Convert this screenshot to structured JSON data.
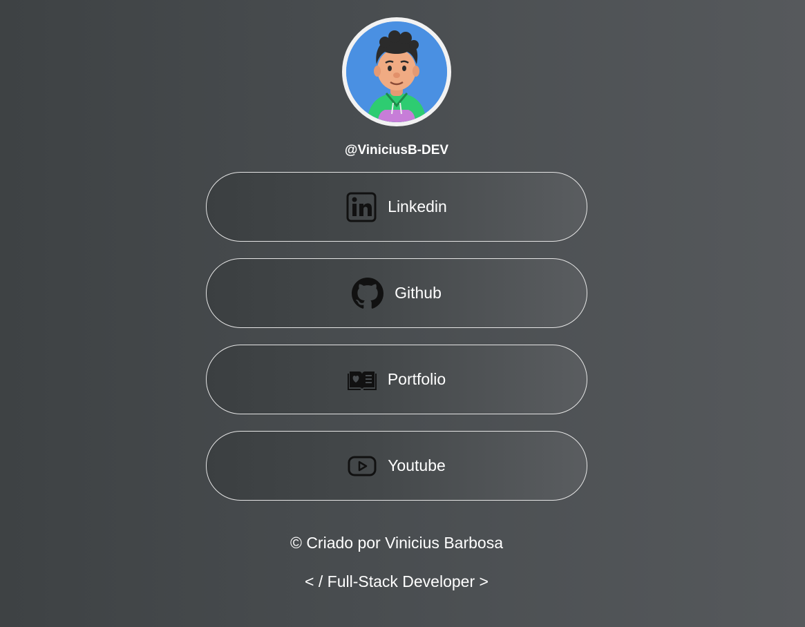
{
  "profile": {
    "handle": "@ViniciusB-DEV"
  },
  "links": [
    {
      "label": "Linkedin",
      "icon": "linkedin-icon"
    },
    {
      "label": "Github",
      "icon": "github-icon"
    },
    {
      "label": "Portfolio",
      "icon": "open-book-icon"
    },
    {
      "label": "Youtube",
      "icon": "youtube-icon"
    }
  ],
  "footer": {
    "credit": "© Criado por Vinicius Barbosa",
    "tagline": "< / Full-Stack Developer >"
  },
  "colors": {
    "background": "#4a4e51",
    "avatar_bg": "#4a90e2",
    "button_border": "#e6e6e6",
    "text": "#ffffff"
  }
}
